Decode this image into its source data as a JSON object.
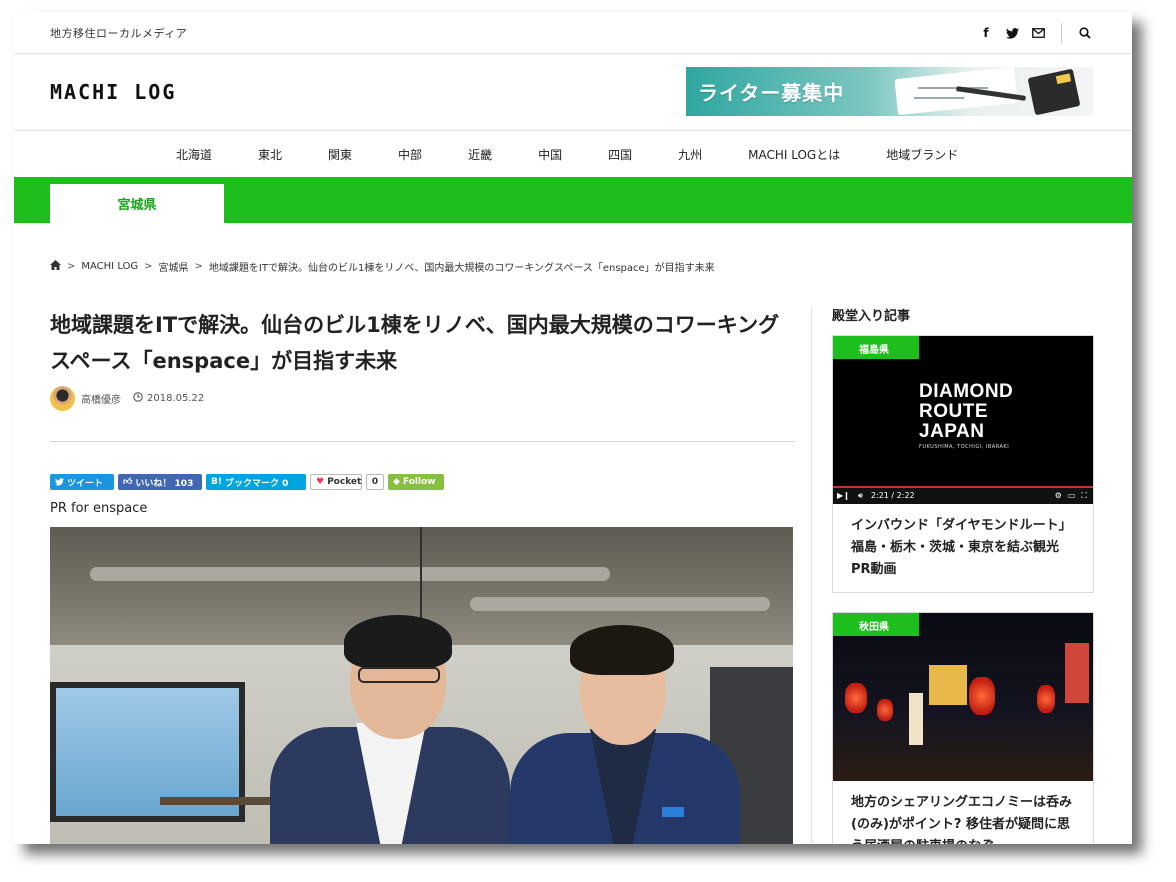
{
  "site": {
    "tagline": "地方移住ローカルメディア",
    "logo": "MACHI LOG",
    "banner_text": "ライター募集中"
  },
  "social_icons": [
    "facebook-icon",
    "twitter-icon",
    "mail-icon",
    "search-icon"
  ],
  "nav": {
    "items": [
      "北海道",
      "東北",
      "関東",
      "中部",
      "近畿",
      "中国",
      "四国",
      "九州",
      "MACHI LOGとは",
      "地域ブランド"
    ]
  },
  "region_tab": "宮城県",
  "breadcrumb": {
    "items": [
      "MACHI LOG",
      "宮城県",
      "地域課題をITで解決。仙台のビル1棟をリノベ、国内最大規模のコワーキングスペース「enspace」が目指す未来"
    ]
  },
  "article": {
    "title": "地域課題をITで解決。仙台のビル1棟をリノベ、国内最大規模のコワーキングスペース「enspace」が目指す未来",
    "author": "高橋優彦",
    "date": "2018.05.22",
    "pr_label": "PR for enspace"
  },
  "share": {
    "tweet": "ツイート",
    "like": "いいね！ 103",
    "bookmark": "ブックマーク 0",
    "pocket": "Pocket",
    "pocket_count": "0",
    "follow": "Follow"
  },
  "sidebar": {
    "title": "殿堂入り記事",
    "cards": [
      {
        "badge": "福島県",
        "video_title_lines": [
          "DIAMOND",
          "ROUTE",
          "JAPAN"
        ],
        "video_sub": "FUKUSHIMA, TOCHIGI, IBARAKI",
        "video_time": "2:21 / 2:22",
        "text": "インバウンド「ダイヤモンドルート」福島・栃木・茨城・東京を結ぶ観光PR動画"
      },
      {
        "badge": "秋田県",
        "text": "地方のシェアリングエコノミーは呑み(のみ)がポイント? 移住者が疑問に思う居酒屋の駐車場のなぞ"
      }
    ]
  },
  "colors": {
    "brand_green": "#1cbf1c",
    "twitter_blue": "#1b95e0",
    "facebook_blue": "#4267b2",
    "hatena_blue": "#00a4de",
    "feedly_green": "#87c040"
  }
}
